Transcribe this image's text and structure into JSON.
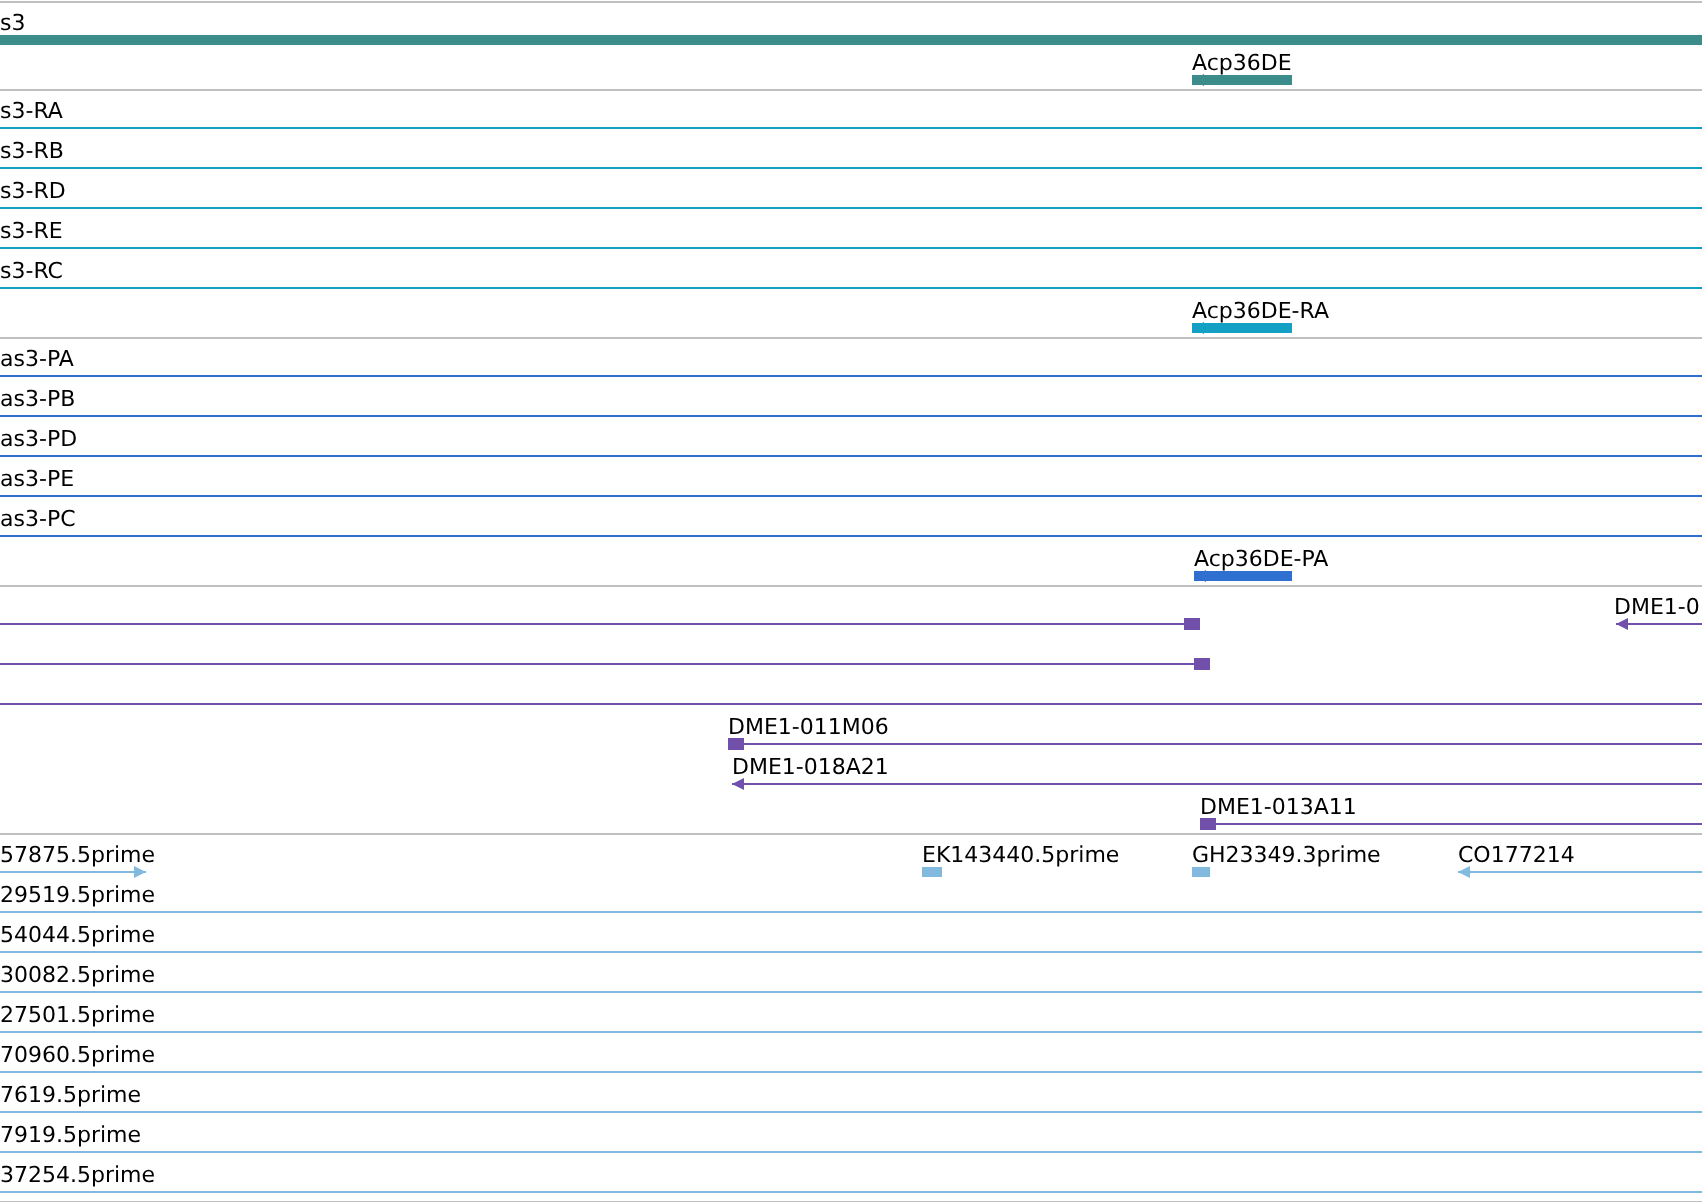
{
  "tracks": [
    {
      "kind": "gene",
      "features": [
        {
          "label": "s3"
        },
        {
          "label": "Acp36DE"
        }
      ]
    },
    {
      "kind": "transcript",
      "features": [
        {
          "label": "s3-RA"
        },
        {
          "label": "s3-RB"
        },
        {
          "label": "s3-RD"
        },
        {
          "label": "s3-RE"
        },
        {
          "label": "s3-RC"
        },
        {
          "label": "Acp36DE-RA"
        }
      ]
    },
    {
      "kind": "protein",
      "features": [
        {
          "label": "as3-PA"
        },
        {
          "label": "as3-PB"
        },
        {
          "label": "as3-PD"
        },
        {
          "label": "as3-PE"
        },
        {
          "label": "as3-PC"
        },
        {
          "label": "Acp36DE-PA"
        }
      ]
    },
    {
      "kind": "clone",
      "features": [
        {
          "label": "DME1-0"
        },
        {
          "label": "DME1-011M06"
        },
        {
          "label": "DME1-018A21"
        },
        {
          "label": "DME1-013A11"
        }
      ]
    },
    {
      "kind": "est",
      "features": [
        {
          "label": "57875.5prime"
        },
        {
          "label": "EK143440.5prime"
        },
        {
          "label": "GH23349.3prime"
        },
        {
          "label": "CO177214"
        },
        {
          "label": "29519.5prime"
        },
        {
          "label": "54044.5prime"
        },
        {
          "label": "30082.5prime"
        },
        {
          "label": "27501.5prime"
        },
        {
          "label": "70960.5prime"
        },
        {
          "label": "7619.5prime"
        },
        {
          "label": "7919.5prime"
        },
        {
          "label": "37254.5prime"
        }
      ]
    }
  ]
}
